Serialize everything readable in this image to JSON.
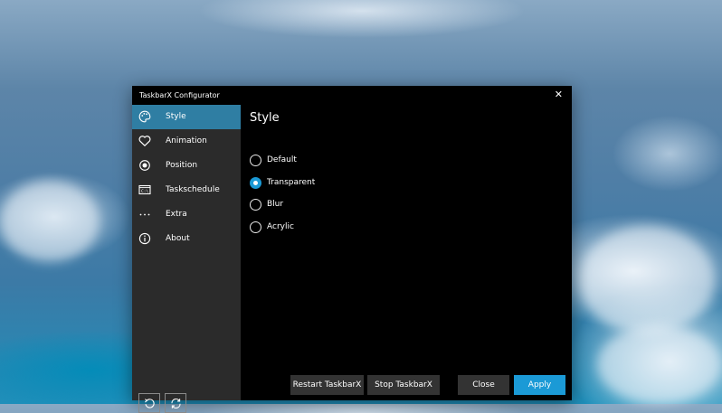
{
  "window": {
    "title": "TaskbarX Configurator",
    "close_glyph": "✕"
  },
  "sidebar": {
    "items": [
      {
        "label": "Style",
        "icon": "palette-icon",
        "active": true
      },
      {
        "label": "Animation",
        "icon": "heart-icon",
        "active": false
      },
      {
        "label": "Position",
        "icon": "radio-target-icon",
        "active": false
      },
      {
        "label": "Taskschedule",
        "icon": "console-icon",
        "active": false
      },
      {
        "label": "Extra",
        "icon": "more-dots-icon",
        "active": false
      },
      {
        "label": "About",
        "icon": "info-icon",
        "active": false
      }
    ],
    "bottom_buttons": [
      {
        "icon": "undo-icon"
      },
      {
        "icon": "refresh-icon"
      }
    ]
  },
  "content": {
    "title": "Style",
    "options": [
      {
        "label": "Default",
        "checked": false
      },
      {
        "label": "Transparent",
        "checked": true
      },
      {
        "label": "Blur",
        "checked": false
      },
      {
        "label": "Acrylic",
        "checked": false
      }
    ]
  },
  "footer": {
    "restart_label": "Restart TaskbarX",
    "stop_label": "Stop TaskbarX",
    "close_label": "Close",
    "apply_label": "Apply"
  },
  "colors": {
    "accent": "#1b9ad6",
    "active_nav": "#2f7ea3",
    "sidebar_bg": "#2b2b2b",
    "content_bg": "#000000",
    "button_bg": "#333333"
  }
}
